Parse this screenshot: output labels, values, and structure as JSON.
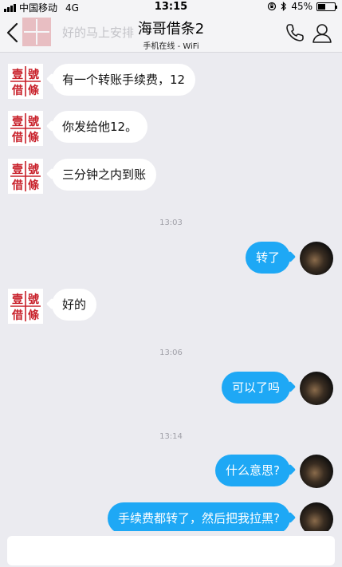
{
  "status_bar": {
    "carrier": "中国移动",
    "network": "4G",
    "time": "13:15",
    "battery_percent": "45%",
    "battery_level": 0.45
  },
  "header": {
    "title": "海哥借条2",
    "subtitle": "手机在线 - WiFi",
    "notification_preview": "好的马上安排"
  },
  "messages": [
    {
      "side": "in",
      "text": "有一个转账手续费，12"
    },
    {
      "side": "in",
      "text": "你发给他12。"
    },
    {
      "side": "in",
      "text": "三分钟之内到账"
    },
    {
      "type": "time",
      "text": "13:03"
    },
    {
      "side": "out",
      "text": "转了"
    },
    {
      "side": "in",
      "text": "好的"
    },
    {
      "type": "time",
      "text": "13:06"
    },
    {
      "side": "out",
      "text": "可以了吗"
    },
    {
      "type": "time",
      "text": "13:14"
    },
    {
      "side": "out",
      "text": "什么意思?"
    },
    {
      "side": "out",
      "text": "手续费都转了，然后把我拉黑?"
    }
  ],
  "seal": {
    "chars": [
      "壹",
      "號",
      "借",
      "條"
    ],
    "color": "#c8202a"
  },
  "colors": {
    "outgoing_bubble": "#1ea8f5",
    "incoming_bubble": "#ffffff",
    "background": "#ebebf0"
  },
  "input": {
    "placeholder": ""
  }
}
